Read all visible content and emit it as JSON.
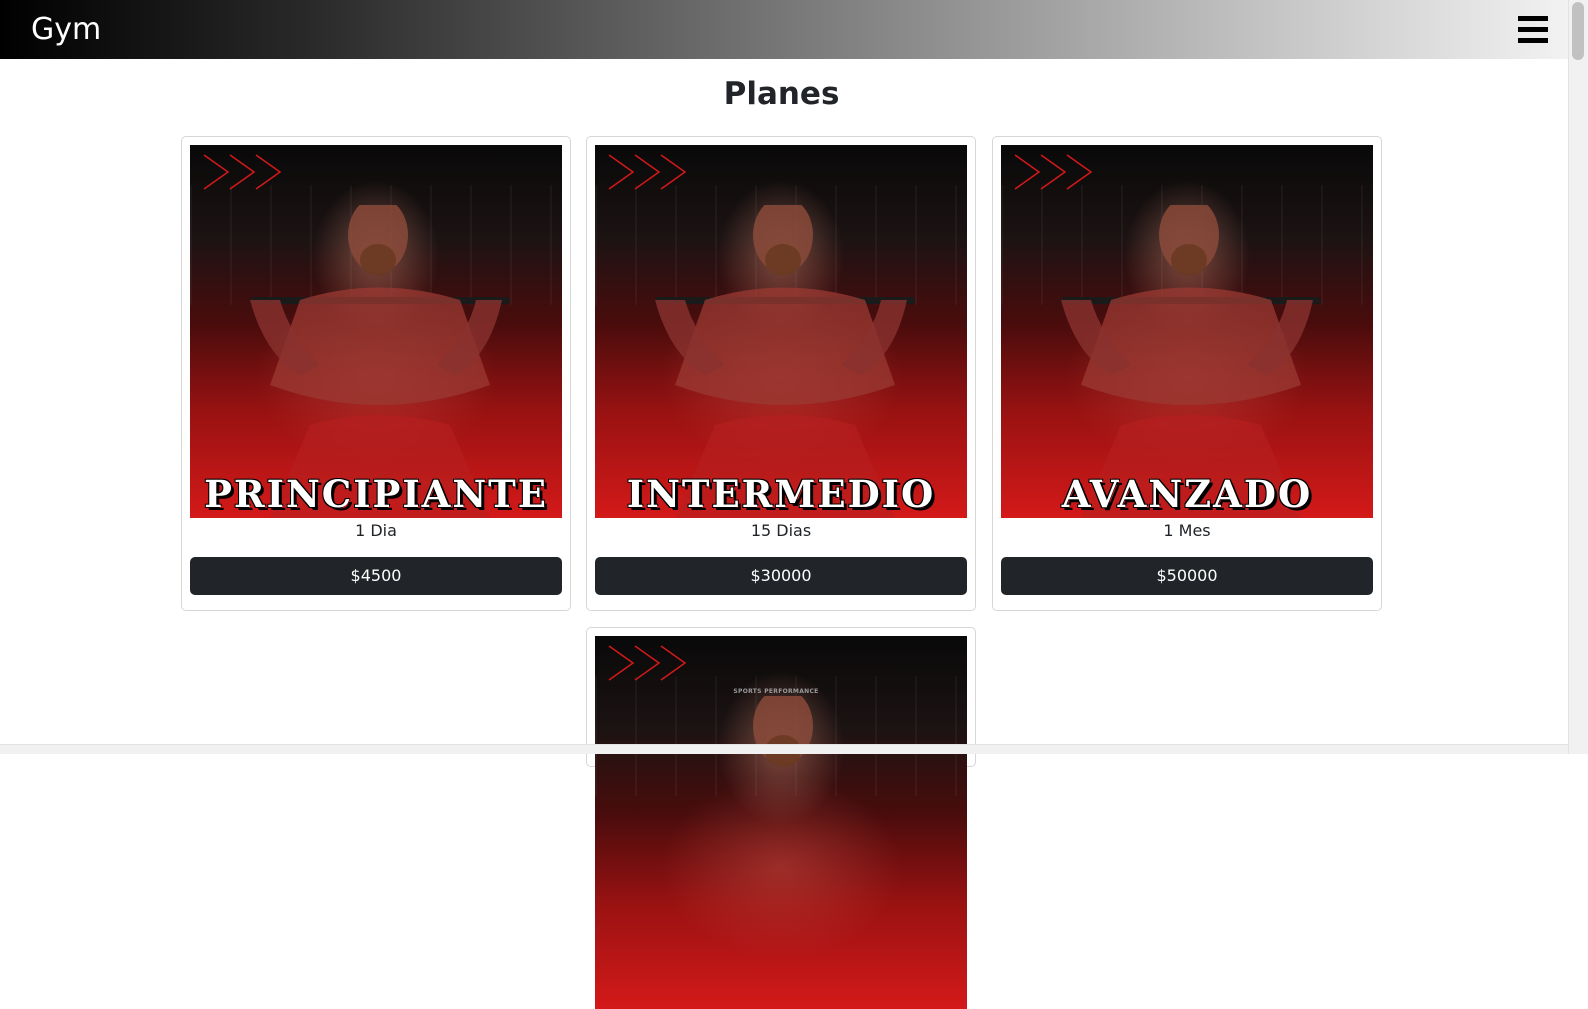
{
  "navbar": {
    "brand": "Gym",
    "menu_icon": "hamburger-menu-icon"
  },
  "page": {
    "title": "Planes"
  },
  "colors": {
    "button_bg": "#212529",
    "accent_red": "#d41919",
    "navbar_start": "#000000",
    "navbar_end": "#f2f2f2"
  },
  "plans": [
    {
      "label": "PRINCIPIANTE",
      "duration": "1 Dia",
      "price": "$4500"
    },
    {
      "label": "INTERMEDIO",
      "duration": "15 Dias",
      "price": "$30000"
    },
    {
      "label": "AVANZADO",
      "duration": "1 Mes",
      "price": "$50000"
    },
    {
      "logo_text": "SPORTS PERFORMANCE"
    }
  ]
}
